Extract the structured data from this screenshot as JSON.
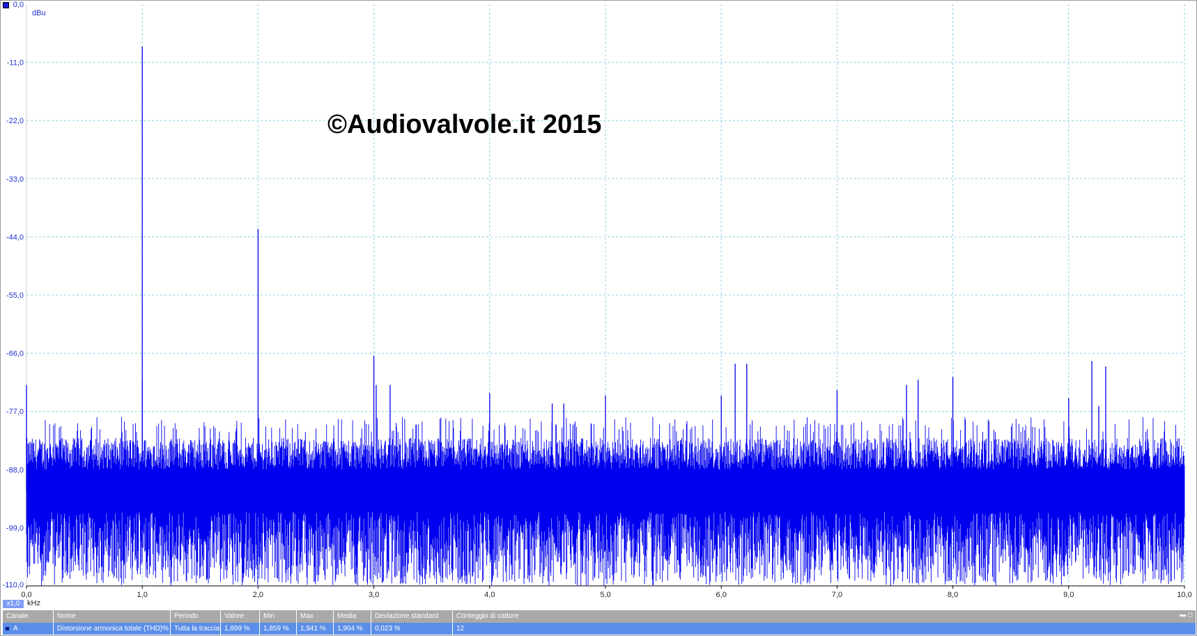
{
  "watermark": "©Audiovalvole.it 2015",
  "zoom": "x1,0",
  "chart_data": {
    "type": "line",
    "title": "",
    "xlabel": "kHz",
    "ylabel": "dBu",
    "xlim": [
      0,
      10
    ],
    "ylim": [
      -110,
      0
    ],
    "grid": true,
    "xticks": [
      "0,0",
      "1,0",
      "2,0",
      "3,0",
      "4,0",
      "5,0",
      "6,0",
      "7,0",
      "8,0",
      "9,0",
      "10,0"
    ],
    "yticks": [
      "0,0",
      "-11,0",
      "-22,0",
      "-33,0",
      "-44,0",
      "-55,0",
      "-66,0",
      "-77,0",
      "-88,0",
      "-99,0",
      "-110,0"
    ],
    "series": [
      {
        "color": "#0000ee",
        "noise_floor_db": {
          "mean": -92,
          "min": -110,
          "max": -80
        },
        "peaks": [
          {
            "x": 0.0,
            "y": -72.0
          },
          {
            "x": 1.0,
            "y": -8.0
          },
          {
            "x": 1.0,
            "y": -71.0
          },
          {
            "x": 2.0,
            "y": -42.5
          },
          {
            "x": 3.0,
            "y": -66.5
          },
          {
            "x": 3.02,
            "y": -72.0
          },
          {
            "x": 3.14,
            "y": -72.0
          },
          {
            "x": 4.0,
            "y": -73.5
          },
          {
            "x": 4.54,
            "y": -75.5
          },
          {
            "x": 4.64,
            "y": -75.5
          },
          {
            "x": 5.0,
            "y": -74.0
          },
          {
            "x": 6.0,
            "y": -74.0
          },
          {
            "x": 6.12,
            "y": -68.0
          },
          {
            "x": 6.22,
            "y": -68.0
          },
          {
            "x": 7.0,
            "y": -73.0
          },
          {
            "x": 7.6,
            "y": -72.0
          },
          {
            "x": 7.7,
            "y": -71.0
          },
          {
            "x": 8.0,
            "y": -70.5
          },
          {
            "x": 9.0,
            "y": -74.5
          },
          {
            "x": 9.2,
            "y": -67.5
          },
          {
            "x": 9.26,
            "y": -76.0
          },
          {
            "x": 9.32,
            "y": -68.5
          }
        ]
      }
    ]
  },
  "measurements": {
    "headers": [
      "Canale",
      "Nome",
      "Periodo",
      "Valore",
      "Min",
      "Max",
      "Media",
      "Deviazione standard",
      "Conteggio di catture"
    ],
    "rows": [
      [
        "A",
        "Distorsione armonica totale (THD)%",
        "Tutta la traccia",
        "1,899 %",
        "1,859 %",
        "1,941 %",
        "1,904 %",
        "0,023 %",
        "12"
      ]
    ]
  }
}
